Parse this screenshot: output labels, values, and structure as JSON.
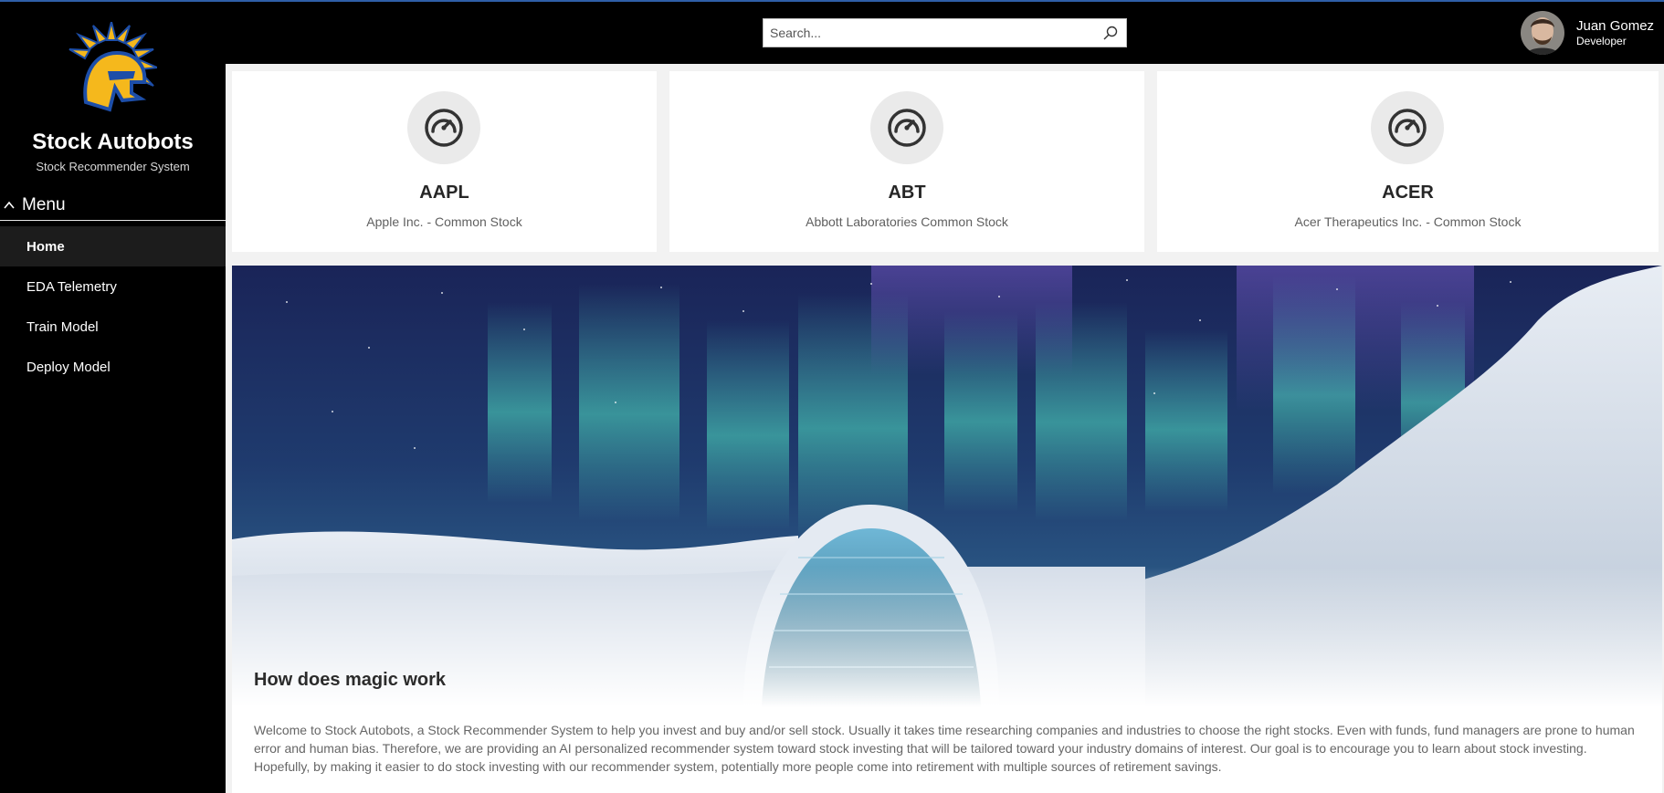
{
  "sidebar": {
    "brand": "Stock Autobots",
    "subtitle": "Stock Recommender System",
    "menu_label": "Menu",
    "items": [
      {
        "label": "Home",
        "active": true
      },
      {
        "label": "EDA Telemetry",
        "active": false
      },
      {
        "label": "Train Model",
        "active": false
      },
      {
        "label": "Deploy Model",
        "active": false
      }
    ]
  },
  "header": {
    "search_placeholder": "Search...",
    "user_name": "Juan Gomez",
    "user_role": "Developer"
  },
  "cards": [
    {
      "symbol": "AAPL",
      "name": "Apple Inc. - Common Stock",
      "icon": "speedometer-icon"
    },
    {
      "symbol": "ABT",
      "name": "Abbott Laboratories Common Stock",
      "icon": "speedometer-icon"
    },
    {
      "symbol": "ACER",
      "name": "Acer Therapeutics Inc. - Common Stock",
      "icon": "speedometer-icon"
    }
  ],
  "hero": {
    "title": "How does magic work",
    "body": "Welcome to Stock Autobots, a Stock Recommender System to help you invest and buy and/or sell stock. Usually it takes time researching companies and industries to choose the right stocks. Even with funds, fund managers are prone to human error and human bias. Therefore, we are providing an AI personalized recommender system toward stock investing that will be tailored toward your industry domains of interest. Our goal is to encourage you to learn about stock investing. Hopefully, by making it easier to do stock investing with our recommender system, potentially more people come into retirement with multiple sources of retirement savings."
  },
  "colors": {
    "sidebar_bg": "#000000",
    "accent_top_line": "#2f5fa8",
    "logo_gold": "#f5b81c",
    "logo_blue": "#1d4ea8"
  }
}
